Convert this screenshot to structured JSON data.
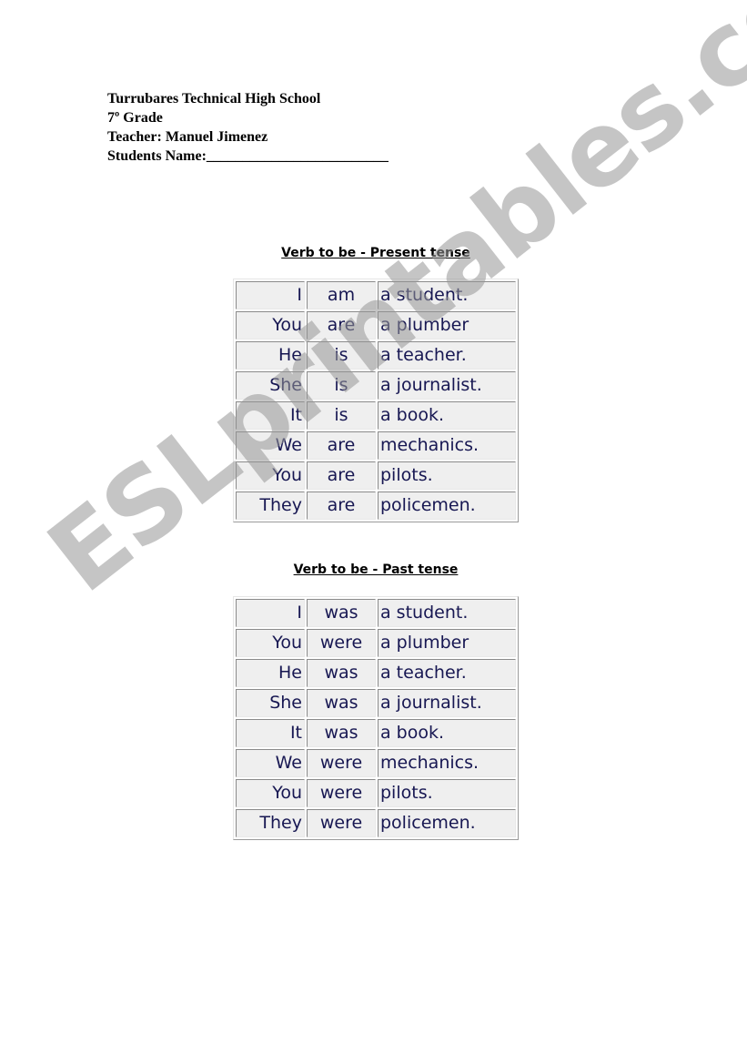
{
  "header": {
    "school": "Turrubares Technical High School",
    "grade": "7º Grade",
    "teacher": "Teacher: Manuel Jimenez",
    "student_name": "Students Name:_________________________"
  },
  "present": {
    "title": "Verb to be - Present tense",
    "rows": [
      [
        "I",
        "am",
        "a student."
      ],
      [
        "You",
        "are",
        "a plumber"
      ],
      [
        "He",
        "is",
        "a teacher."
      ],
      [
        "She",
        "is",
        "a journalist."
      ],
      [
        "It",
        "is",
        "a book."
      ],
      [
        "We",
        "are",
        "mechanics."
      ],
      [
        "You",
        "are",
        "pilots."
      ],
      [
        "They",
        "are",
        "policemen."
      ]
    ]
  },
  "past": {
    "title": "Verb to be - Past tense",
    "rows": [
      [
        "I",
        "was",
        "a student."
      ],
      [
        "You",
        "were",
        "a plumber"
      ],
      [
        "He",
        "was",
        "a teacher."
      ],
      [
        "She",
        "was",
        "a journalist."
      ],
      [
        "It",
        "was",
        "a book."
      ],
      [
        "We",
        "were",
        "mechanics."
      ],
      [
        "You",
        "were",
        "pilots."
      ],
      [
        "They",
        "were",
        "policemen."
      ]
    ]
  },
  "watermark": "ESLprintables.com",
  "colors": {
    "cell_text": "#171752",
    "cell_background": "#efefef",
    "watermark": "#969696"
  }
}
